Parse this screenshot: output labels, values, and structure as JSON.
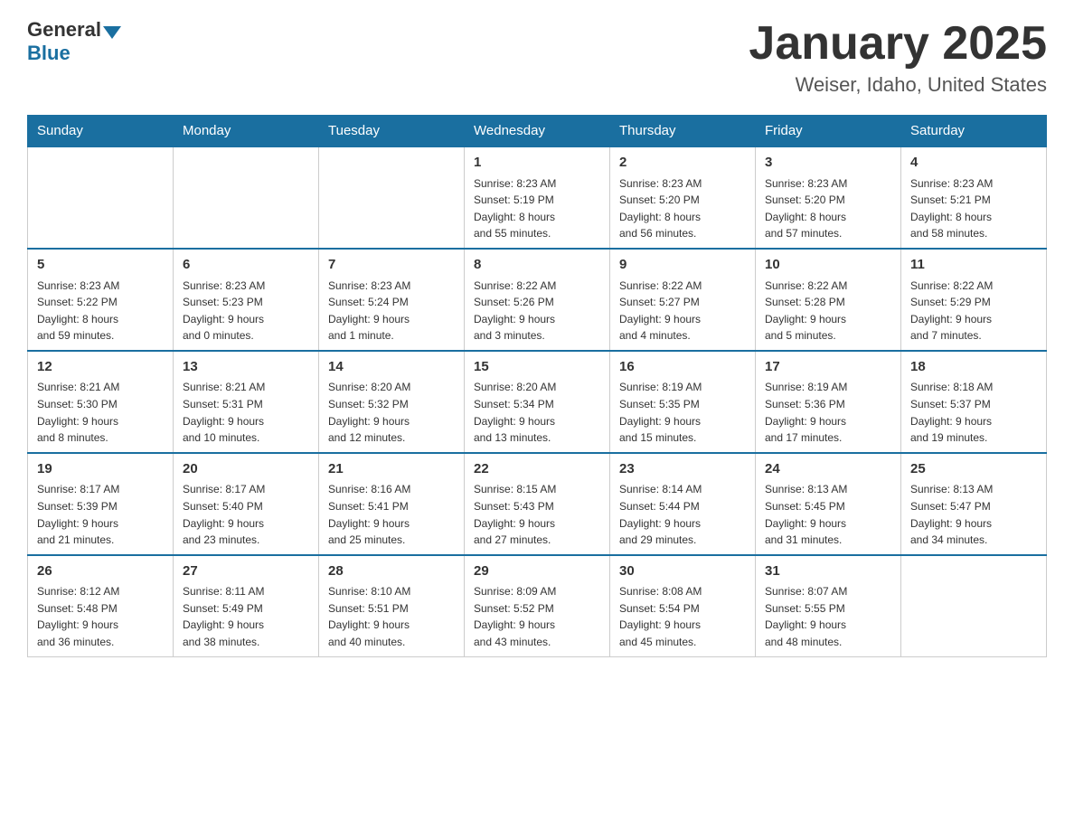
{
  "header": {
    "logo_general": "General",
    "logo_blue": "Blue",
    "title": "January 2025",
    "subtitle": "Weiser, Idaho, United States"
  },
  "days_of_week": [
    "Sunday",
    "Monday",
    "Tuesday",
    "Wednesday",
    "Thursday",
    "Friday",
    "Saturday"
  ],
  "weeks": [
    [
      {
        "day": "",
        "info": ""
      },
      {
        "day": "",
        "info": ""
      },
      {
        "day": "",
        "info": ""
      },
      {
        "day": "1",
        "info": "Sunrise: 8:23 AM\nSunset: 5:19 PM\nDaylight: 8 hours\nand 55 minutes."
      },
      {
        "day": "2",
        "info": "Sunrise: 8:23 AM\nSunset: 5:20 PM\nDaylight: 8 hours\nand 56 minutes."
      },
      {
        "day": "3",
        "info": "Sunrise: 8:23 AM\nSunset: 5:20 PM\nDaylight: 8 hours\nand 57 minutes."
      },
      {
        "day": "4",
        "info": "Sunrise: 8:23 AM\nSunset: 5:21 PM\nDaylight: 8 hours\nand 58 minutes."
      }
    ],
    [
      {
        "day": "5",
        "info": "Sunrise: 8:23 AM\nSunset: 5:22 PM\nDaylight: 8 hours\nand 59 minutes."
      },
      {
        "day": "6",
        "info": "Sunrise: 8:23 AM\nSunset: 5:23 PM\nDaylight: 9 hours\nand 0 minutes."
      },
      {
        "day": "7",
        "info": "Sunrise: 8:23 AM\nSunset: 5:24 PM\nDaylight: 9 hours\nand 1 minute."
      },
      {
        "day": "8",
        "info": "Sunrise: 8:22 AM\nSunset: 5:26 PM\nDaylight: 9 hours\nand 3 minutes."
      },
      {
        "day": "9",
        "info": "Sunrise: 8:22 AM\nSunset: 5:27 PM\nDaylight: 9 hours\nand 4 minutes."
      },
      {
        "day": "10",
        "info": "Sunrise: 8:22 AM\nSunset: 5:28 PM\nDaylight: 9 hours\nand 5 minutes."
      },
      {
        "day": "11",
        "info": "Sunrise: 8:22 AM\nSunset: 5:29 PM\nDaylight: 9 hours\nand 7 minutes."
      }
    ],
    [
      {
        "day": "12",
        "info": "Sunrise: 8:21 AM\nSunset: 5:30 PM\nDaylight: 9 hours\nand 8 minutes."
      },
      {
        "day": "13",
        "info": "Sunrise: 8:21 AM\nSunset: 5:31 PM\nDaylight: 9 hours\nand 10 minutes."
      },
      {
        "day": "14",
        "info": "Sunrise: 8:20 AM\nSunset: 5:32 PM\nDaylight: 9 hours\nand 12 minutes."
      },
      {
        "day": "15",
        "info": "Sunrise: 8:20 AM\nSunset: 5:34 PM\nDaylight: 9 hours\nand 13 minutes."
      },
      {
        "day": "16",
        "info": "Sunrise: 8:19 AM\nSunset: 5:35 PM\nDaylight: 9 hours\nand 15 minutes."
      },
      {
        "day": "17",
        "info": "Sunrise: 8:19 AM\nSunset: 5:36 PM\nDaylight: 9 hours\nand 17 minutes."
      },
      {
        "day": "18",
        "info": "Sunrise: 8:18 AM\nSunset: 5:37 PM\nDaylight: 9 hours\nand 19 minutes."
      }
    ],
    [
      {
        "day": "19",
        "info": "Sunrise: 8:17 AM\nSunset: 5:39 PM\nDaylight: 9 hours\nand 21 minutes."
      },
      {
        "day": "20",
        "info": "Sunrise: 8:17 AM\nSunset: 5:40 PM\nDaylight: 9 hours\nand 23 minutes."
      },
      {
        "day": "21",
        "info": "Sunrise: 8:16 AM\nSunset: 5:41 PM\nDaylight: 9 hours\nand 25 minutes."
      },
      {
        "day": "22",
        "info": "Sunrise: 8:15 AM\nSunset: 5:43 PM\nDaylight: 9 hours\nand 27 minutes."
      },
      {
        "day": "23",
        "info": "Sunrise: 8:14 AM\nSunset: 5:44 PM\nDaylight: 9 hours\nand 29 minutes."
      },
      {
        "day": "24",
        "info": "Sunrise: 8:13 AM\nSunset: 5:45 PM\nDaylight: 9 hours\nand 31 minutes."
      },
      {
        "day": "25",
        "info": "Sunrise: 8:13 AM\nSunset: 5:47 PM\nDaylight: 9 hours\nand 34 minutes."
      }
    ],
    [
      {
        "day": "26",
        "info": "Sunrise: 8:12 AM\nSunset: 5:48 PM\nDaylight: 9 hours\nand 36 minutes."
      },
      {
        "day": "27",
        "info": "Sunrise: 8:11 AM\nSunset: 5:49 PM\nDaylight: 9 hours\nand 38 minutes."
      },
      {
        "day": "28",
        "info": "Sunrise: 8:10 AM\nSunset: 5:51 PM\nDaylight: 9 hours\nand 40 minutes."
      },
      {
        "day": "29",
        "info": "Sunrise: 8:09 AM\nSunset: 5:52 PM\nDaylight: 9 hours\nand 43 minutes."
      },
      {
        "day": "30",
        "info": "Sunrise: 8:08 AM\nSunset: 5:54 PM\nDaylight: 9 hours\nand 45 minutes."
      },
      {
        "day": "31",
        "info": "Sunrise: 8:07 AM\nSunset: 5:55 PM\nDaylight: 9 hours\nand 48 minutes."
      },
      {
        "day": "",
        "info": ""
      }
    ]
  ]
}
